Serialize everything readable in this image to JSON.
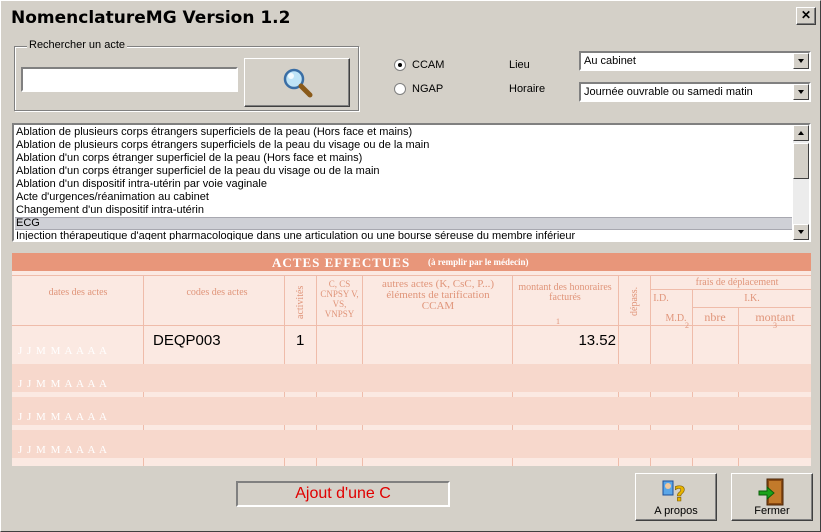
{
  "window": {
    "title": "NomenclatureMG Version 1.2",
    "close_glyph": "✕"
  },
  "search": {
    "group_label": "Rechercher un acte",
    "value": "",
    "button_icon": "magnifier-icon"
  },
  "coding": {
    "ccam_label": "CCAM",
    "ngap_label": "NGAP",
    "selected": "CCAM"
  },
  "lieu": {
    "label": "Lieu",
    "value": "Au cabinet"
  },
  "horaire": {
    "label": "Horaire",
    "value": "Journée ouvrable ou samedi matin"
  },
  "acts_list": {
    "items": [
      "Ablation de plusieurs corps étrangers superficiels de la peau (Hors face et mains)",
      "Ablation de plusieurs corps étrangers superficiels de la peau du visage ou de la main",
      "Ablation d'un corps étranger superficiel de la peau (Hors face et mains)",
      "Ablation d'un corps étranger superficiel de la peau du visage ou de la main",
      "Ablation d'un dispositif intra-utérin par voie vaginale",
      "Acte d'urgences/réanimation au cabinet",
      "Changement d'un dispositif intra-utérin",
      "ECG",
      "Injection thérapeutique d'agent pharmacologique dans une articulation ou une bourse séreuse du membre inférieur"
    ],
    "selected_index": 7
  },
  "form": {
    "title": "ACTES EFFECTUES",
    "subtitle": "(à remplir par le médecin)",
    "col_dates": "dates des actes",
    "col_codes": "codes des actes",
    "col_activites": "activités",
    "col_c": "C, CS CNPSY V, VS, VNPSY",
    "col_autres": "autres actes (K, CsC, P...) éléments de tarification CCAM",
    "col_montant": "montant des honoraires facturés",
    "col_montant_note": "1",
    "col_depass": "dépass.",
    "col_frais": "frais de déplacement",
    "col_id": "I.D.",
    "col_ik": "I.K.",
    "col_md": "M.D.",
    "col_md_note": "2",
    "col_nbre": "nbre",
    "col_ik_montant": "montant",
    "col_ik_montant_note": "3",
    "date_mask": "J J M M A A A A",
    "row1": {
      "code": "DEQP003",
      "activite": "1",
      "montant": "13.52"
    }
  },
  "status_text": "Ajout d'une C",
  "buttons": {
    "apropos": "A propos",
    "fermer": "Fermer"
  },
  "colors": {
    "form_bg": "#fbe9e2",
    "form_header": "#e8967a",
    "status_red": "#e00000"
  }
}
